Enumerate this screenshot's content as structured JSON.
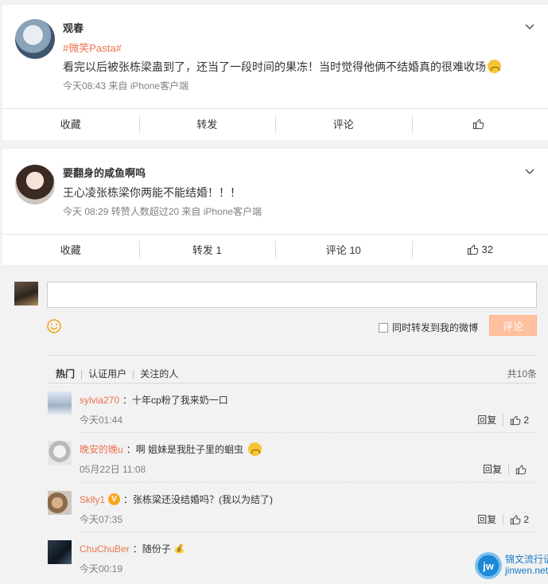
{
  "posts": [
    {
      "author": "观春",
      "topic": "#微笑Pasta#",
      "text": "看完以后被张栋梁蛊到了，还当了一段时间的果冻！当时觉得他俩不结婚真的很难收场",
      "meta": "今天08:43  来自 iPhone客户端",
      "actions": {
        "favorite": "收藏",
        "repost": "转发",
        "comment": "评论",
        "like": ""
      }
    },
    {
      "author": "要翻身的咸鱼啊呜",
      "text": "王心凌张栋梁你两能不能结婚！！！",
      "meta": "今天 08:29 转赞人数超过20  来自 iPhone客户端",
      "actions": {
        "favorite": "收藏",
        "repost": "转发 1",
        "comment": "评论 10",
        "like": "32"
      }
    }
  ],
  "composer": {
    "forward_label": "同时转发到我的微博",
    "submit_label": "评论"
  },
  "filters": {
    "tabs": [
      "热门",
      "认证用户",
      "关注的人"
    ],
    "total": "共10条"
  },
  "comments": [
    {
      "user": "sylvia270",
      "text": "：十年cp粉了我来奶一口",
      "time": "今天01:44",
      "reply": "回复",
      "likes": "2"
    },
    {
      "user": "晚安的晚u",
      "text": "：啊 姐妹是我肚子里的蛔虫",
      "time": "05月22日 11:08",
      "reply": "回复",
      "likes": ""
    },
    {
      "user": "Sklly1",
      "badge": "V",
      "text": "：张栋梁还没结婚吗？(我以为结了)",
      "time": "今天07:35",
      "reply": "回复",
      "likes": "2"
    },
    {
      "user": "ChuChuBer",
      "text": "：随份子",
      "time": "今天00:19"
    }
  ],
  "watermark": {
    "logo": "jw",
    "line1": "锦文流行语",
    "line2": "jinwen.net"
  },
  "colors": {
    "accent": "#eb7350",
    "submit": "#ffc09f",
    "background": "#f2f2f2"
  }
}
